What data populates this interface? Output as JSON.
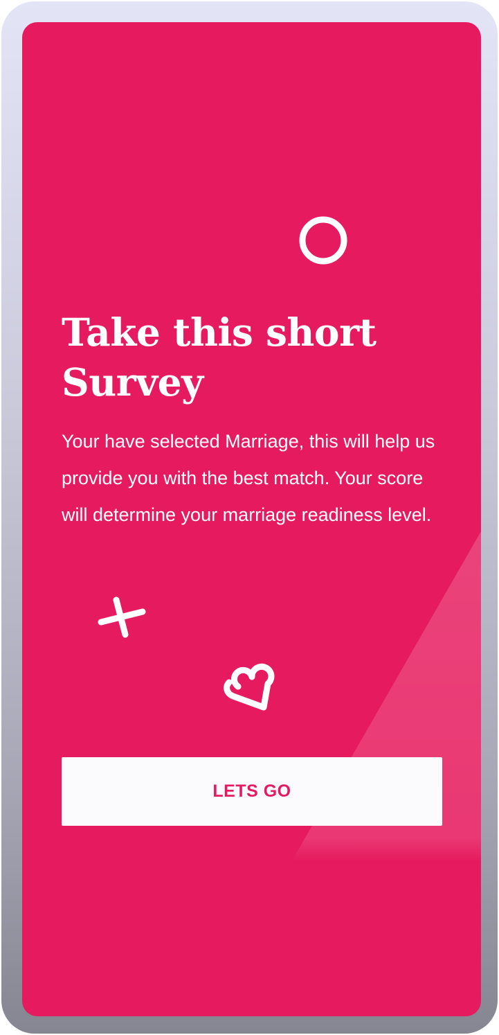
{
  "survey_intro": {
    "title_line1": "Take this short",
    "title_line2": "Survey",
    "description": "Your have selected Marriage, this will help us provide you with the best match. Your score will determine your marriage readiness level.",
    "cta_label": "LETS GO"
  },
  "icons": {
    "top_decoration": "circle-icon",
    "left_decoration": "cross-icon",
    "center_decoration": "heart-icon"
  },
  "colors": {
    "background": "#e61a5e",
    "button_background": "#fbfbfe",
    "button_text": "#e61a5e",
    "text": "#ffffff",
    "frame_top": "#e3e5f7",
    "frame_bottom": "#868692"
  }
}
